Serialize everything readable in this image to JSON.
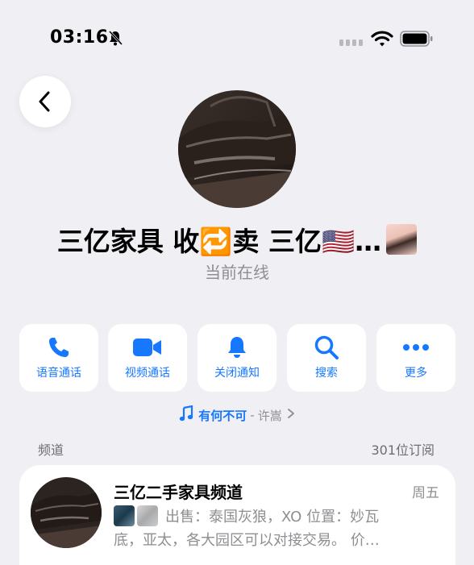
{
  "status_bar": {
    "time": "03:16"
  },
  "profile": {
    "name": "三亿家具 收🔁卖 三亿🇺🇸…",
    "status": "当前在线"
  },
  "actions": [
    {
      "label": "语音通话",
      "icon": "phone-icon"
    },
    {
      "label": "视频通话",
      "icon": "video-icon"
    },
    {
      "label": "关闭通知",
      "icon": "bell-icon"
    },
    {
      "label": "搜索",
      "icon": "search-icon"
    },
    {
      "label": "更多",
      "icon": "more-icon"
    }
  ],
  "music": {
    "title": "有何不可",
    "separator": "-",
    "artist": "许嵩"
  },
  "channel_section": {
    "label": "频道",
    "subscribers": "301位订阅"
  },
  "channel": {
    "title": "三亿二手家具频道",
    "day": "周五",
    "preview_line1": "出售：泰国灰狼，XO 位置：妙瓦",
    "preview_line2": "底，亚太，各大园区可以对接交易。 价…"
  },
  "colors": {
    "accent": "#1677ff",
    "background": "#efeff4",
    "secondary_text": "#8e8e93"
  }
}
